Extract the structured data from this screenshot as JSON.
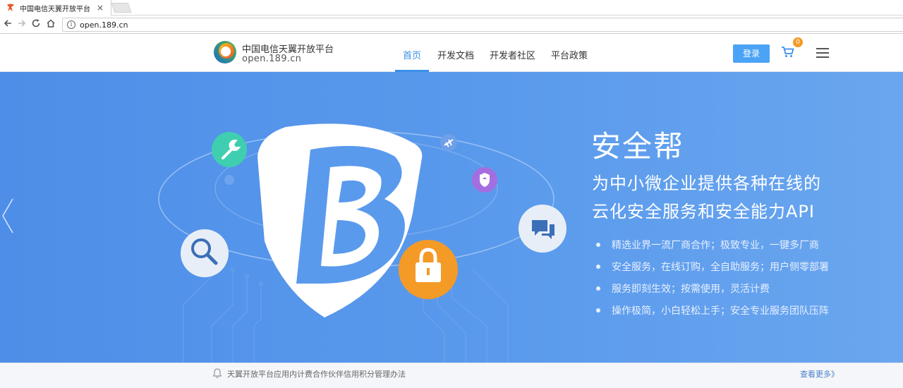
{
  "browser": {
    "tab_title": "中国电信天翼开放平台",
    "tab_close": "×",
    "url": "open.189.cn"
  },
  "header": {
    "brand_name": "中国电信天翼开放平台",
    "brand_domain": "open.189.cn",
    "nav": [
      {
        "label": "首页",
        "active": true
      },
      {
        "label": "开发文档",
        "active": false
      },
      {
        "label": "开发者社区",
        "active": false
      },
      {
        "label": "平台政策",
        "active": false
      }
    ],
    "login_label": "登录",
    "cart_count": "0"
  },
  "hero": {
    "title": "安全帮",
    "subtitle_line1": "为中小微企业提供各种在线的",
    "subtitle_line2": "云化安全服务和安全能力API",
    "bullets": [
      "精选业界一流厂商合作；极致专业，一键多厂商",
      "安全服务，在线订购，全自助服务；用户侧零部署",
      "服务即刻生效；按需使用，灵活计费",
      "操作极简，小白轻松上手；安全专业服务团队压阵"
    ]
  },
  "notice": {
    "text": "天翼开放平台应用内计费合作伙伴信用积分管理办法",
    "more_label": "查看更多》"
  },
  "colors": {
    "accent": "#3b8fe8",
    "login": "#4ba3f6",
    "badge": "#f49a26",
    "hero_bg": "#5a9aec",
    "wrench_circle": "#3fcfb0",
    "shield_circle": "#a46ee0",
    "lock_circle": "#f49a26"
  },
  "icons": [
    "favicon-icon",
    "back-icon",
    "forward-icon",
    "reload-icon",
    "home-icon",
    "info-icon",
    "cart-icon",
    "menu-icon",
    "wrench-icon",
    "search-icon",
    "plane-icon",
    "shield-icon",
    "chat-icon",
    "lock-icon",
    "bell-icon",
    "chevron-left-icon"
  ]
}
